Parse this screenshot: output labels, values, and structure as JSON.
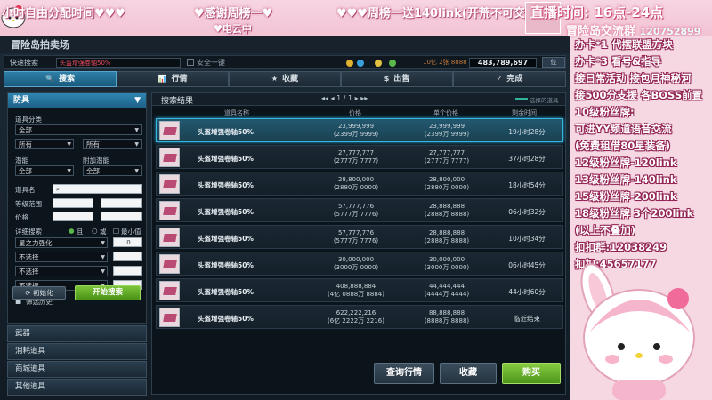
{
  "overlay": {
    "ticker": [
      "小时自由分配时间♥♥♥",
      "♥感谢周榜一♥",
      "♥♥♥周榜一送140link(开荒不可交易",
      "♥电云中"
    ],
    "clock_top": "直播时间: 16点-24点",
    "clock_bottom": "冒险岛交流群",
    "clock_num": "120752899",
    "side_lines": [
      "办卡*1 代摆联盟方块",
      "办卡*3 看号&指导",
      "接日常活动 接包月神秘河",
      "接500分支援 各BOSS前置",
      "10级粉丝牌:",
      "可进YY频道语音交流",
      "(免费租借80星装备)",
      "12级粉丝牌-120link",
      "13级粉丝牌-140link",
      "15级粉丝牌-200link",
      "18级粉丝牌 3个200link",
      "(以上不叠加)",
      "扣扣群:12038249",
      "扣扣:45657177"
    ]
  },
  "game": {
    "window_title": "冒险岛拍卖场",
    "quick_label": "快速搜索",
    "quick_search_value": "头盔增强卷轴50%",
    "safe_label": "安全一键",
    "money_small": "10亿 2张  8888",
    "money_big": "483,789,697",
    "pos_label": "位",
    "tabs": [
      {
        "icon": "🔍",
        "label": "搜索"
      },
      {
        "icon": "📊",
        "label": "行情"
      },
      {
        "icon": "★",
        "label": "收藏"
      },
      {
        "icon": "$",
        "label": "出售"
      },
      {
        "icon": "✓",
        "label": "完成"
      }
    ],
    "filter": {
      "header": "防具",
      "category_label": "道具分类",
      "category_value": "全部",
      "class_value_1": "所有",
      "class_value_2": "所有",
      "latent_label": "潜能",
      "extra_label": "附加潜能",
      "latent_value": "全部",
      "extra_value": "全部",
      "name_label": "道具名",
      "level_label": "等级范围",
      "price_label": "价格",
      "detail_label": "详细搜索",
      "detail_and": "且",
      "detail_or": "或",
      "detail_min": "最小值",
      "star_value": "星之力强化",
      "star_input": "0",
      "nosel": "不选择",
      "history_label": "筛选历史",
      "init_label": "初始化",
      "search_label": "开始搜索"
    },
    "categories": [
      "武器",
      "消耗道具",
      "商城道具",
      "其他道具"
    ],
    "results": {
      "title": "搜索结果",
      "pager": "◂◂  ◂  1 / 1  ▸  ▸▸",
      "legend": "选择的道具",
      "col_name": "道具名称",
      "col_price": "价格",
      "col_unit": "单个价格",
      "col_time": "剩余时间",
      "rows": [
        {
          "name": "头盔增强卷轴50%",
          "p1": "23,999,999",
          "p2": "(2399万 9999)",
          "u1": "23,999,999",
          "u2": "(2399万 9999)",
          "time": "19小时28分"
        },
        {
          "name": "头盔增强卷轴50%",
          "p1": "27,777,777",
          "p2": "(2777万 7777)",
          "u1": "27,777,777",
          "u2": "(2777万 7777)",
          "time": "37小时28分"
        },
        {
          "name": "头盔增强卷轴50%",
          "p1": "28,800,000",
          "p2": "(2880万 0000)",
          "u1": "28,800,000",
          "u2": "(2880万 0000)",
          "time": "18小时54分"
        },
        {
          "name": "头盔增强卷轴50%",
          "p1": "57,777,776",
          "p2": "(5777万 7776)",
          "u1": "28,888,888",
          "u2": "(2888万 8888)",
          "time": "06小时32分"
        },
        {
          "name": "头盔增强卷轴50%",
          "p1": "57,777,776",
          "p2": "(5777万 7776)",
          "u1": "28,888,888",
          "u2": "(2888万 8888)",
          "time": "10小时34分"
        },
        {
          "name": "头盔增强卷轴50%",
          "p1": "30,000,000",
          "p2": "(3000万 0000)",
          "u1": "30,000,000",
          "u2": "(3000万 0000)",
          "time": "06小时45分"
        },
        {
          "name": "头盔增强卷轴50%",
          "p1": "408,888,884",
          "p2": "(4亿 0888万 8884)",
          "u1": "44,444,444",
          "u2": "(4444万 4444)",
          "time": "44小时60分"
        },
        {
          "name": "头盔增强卷轴50%",
          "p1": "622,222,216",
          "p2": "(6亿 2222万 2216)",
          "u1": "88,888,888",
          "u2": "(8888万 8888)",
          "time": "临近结束"
        }
      ],
      "btn_query": "查询行情",
      "btn_fav": "收藏",
      "btn_buy": "购买"
    }
  }
}
